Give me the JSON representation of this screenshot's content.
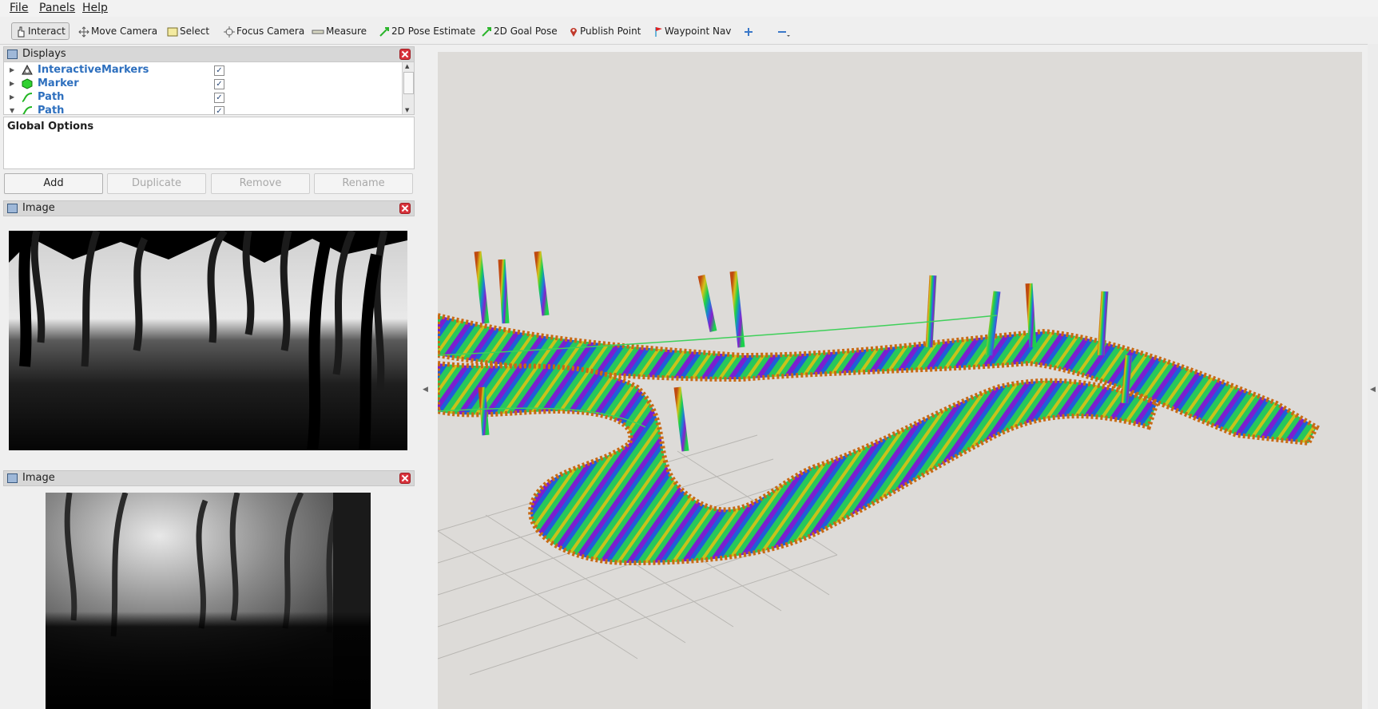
{
  "menu": [
    "File",
    "Panels",
    "Help"
  ],
  "toolbar": {
    "interact": "Interact",
    "move_camera": "Move Camera",
    "select": "Select",
    "focus_camera": "Focus Camera",
    "measure": "Measure",
    "pose_estimate": "2D Pose Estimate",
    "goal_pose": "2D Goal Pose",
    "publish_point": "Publish Point",
    "waypoint_nav": "Waypoint Nav"
  },
  "displays": {
    "title": "Displays",
    "items": [
      {
        "label": "InteractiveMarkers",
        "checked": true,
        "icon": "interactive-markers-icon"
      },
      {
        "label": "Marker",
        "checked": true,
        "icon": "marker-icon"
      },
      {
        "label": "Path",
        "checked": true,
        "icon": "path-icon"
      },
      {
        "label": "Path",
        "checked": true,
        "icon": "path-icon"
      }
    ],
    "global_options": "Global Options",
    "buttons": {
      "add": "Add",
      "duplicate": "Duplicate",
      "remove": "Remove",
      "rename": "Rename"
    }
  },
  "image_panels": [
    {
      "title": "Image"
    },
    {
      "title": "Image"
    }
  ],
  "colors": {
    "accent": "#2d6fbe",
    "viewport_bg": "#dddbd8",
    "close": "#d8323b"
  }
}
